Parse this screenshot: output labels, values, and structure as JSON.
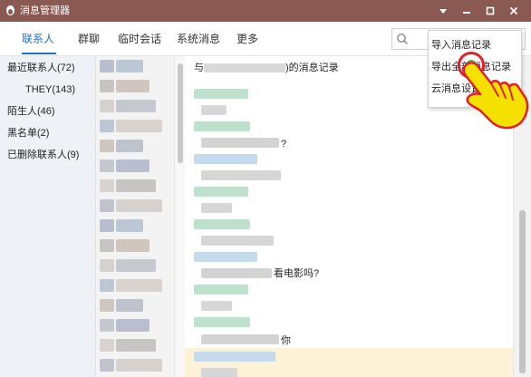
{
  "window": {
    "title": "消息管理器",
    "app_icon": "penguin-icon",
    "controls": [
      "chevron-down-icon",
      "minimize-icon",
      "maximize-icon",
      "close-icon"
    ]
  },
  "tabs": [
    {
      "label": "联系人",
      "active": true
    },
    {
      "label": "群聊",
      "active": false
    },
    {
      "label": "临时会话",
      "active": false
    },
    {
      "label": "系统消息",
      "active": false
    },
    {
      "label": "更多",
      "active": false
    }
  ],
  "search": {
    "icon": "search-icon",
    "placeholder": ""
  },
  "categories": [
    {
      "label": "最近联系人(72)"
    },
    {
      "label": "THEY(143)"
    },
    {
      "label": "陌生人(46)"
    },
    {
      "label": "黑名单(2)"
    },
    {
      "label": "已删除联系人(9)"
    }
  ],
  "conversation": {
    "header_prefix": "与",
    "header_suffix": ")的消息记录",
    "messages": [
      {
        "text": "?"
      },
      {
        "text": "看电影吗?"
      },
      {
        "text": "你"
      }
    ]
  },
  "menu": {
    "items": [
      {
        "label": "导入消息记录"
      },
      {
        "label": "导出全部消息记录"
      },
      {
        "label": "云消息设置"
      }
    ]
  },
  "colors": {
    "titlebar": "#8a5a52",
    "accent": "#1f6fd0",
    "highlight": "#fdf1d6",
    "cursor_ring": "#e0202a",
    "hand": "#f5e100"
  }
}
